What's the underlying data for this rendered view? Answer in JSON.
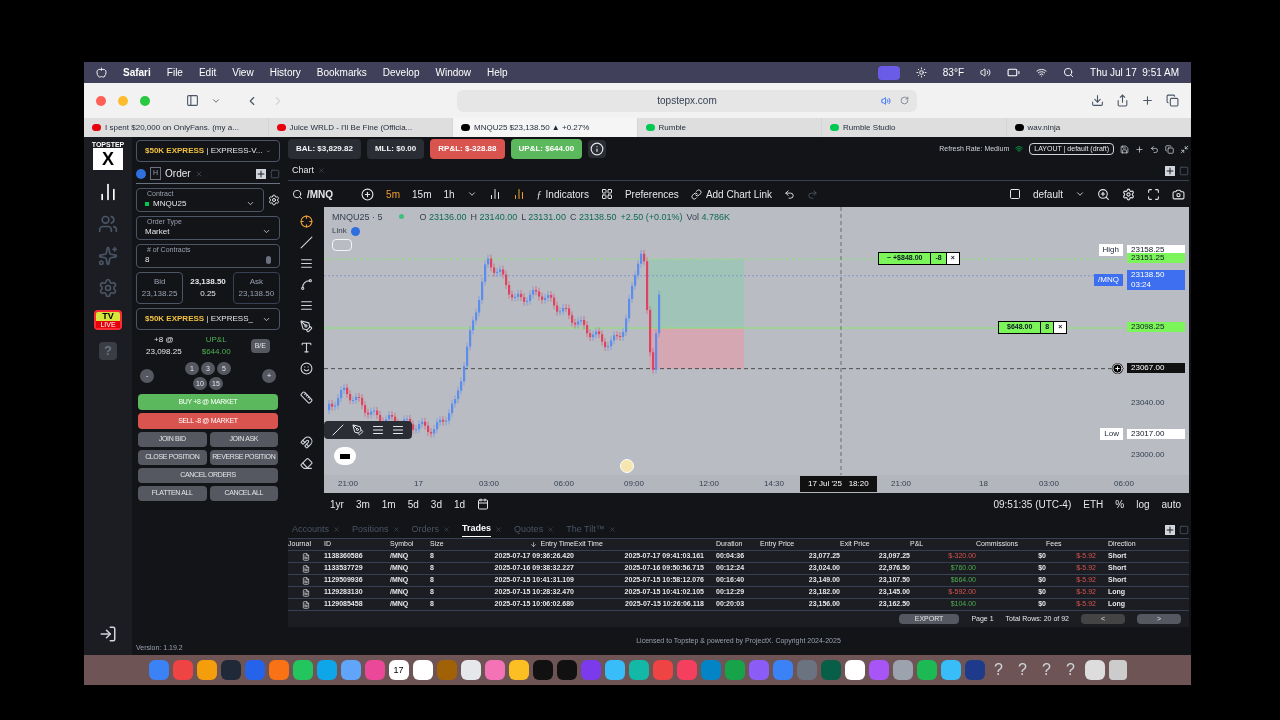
{
  "menubar": {
    "app": "Safari",
    "menus": [
      "File",
      "Edit",
      "View",
      "History",
      "Bookmarks",
      "Develop",
      "Window",
      "Help"
    ],
    "weather": "83°F",
    "clock": "Thu Jul 17  9:51 AM"
  },
  "browser": {
    "url": "topstepx.com",
    "tabs": [
      {
        "title": "I spent $20,000 on OnlyFans. (my a...",
        "selected": false
      },
      {
        "title": "Juice WRLD - I'll Be Fine (Officia...",
        "selected": false
      },
      {
        "title": "MNQU25 $23,138.50 ▲ +0.27%",
        "selected": true
      },
      {
        "title": "Rumble",
        "selected": false
      },
      {
        "title": "Rumble Studio",
        "selected": false
      },
      {
        "title": "wav.ninja",
        "selected": false
      }
    ]
  },
  "rail": {
    "logo_word": "TOPSTEP",
    "logo_letter": "X",
    "tv": "TV",
    "live": "LIVE",
    "help": "?"
  },
  "order_panel": {
    "account": {
      "plan": "$50K EXPRESS",
      "name": "EXPRESS-V..."
    },
    "tab": "Order",
    "tab_badge": "H",
    "fields": [
      {
        "label": "Contract",
        "value": "MNQU25",
        "kind": "select"
      },
      {
        "label": "Order Type",
        "value": "Market",
        "kind": "select"
      },
      {
        "label": "# of Contracts",
        "value": "8",
        "kind": "number"
      }
    ],
    "bid": {
      "label": "Bid",
      "value": "23,138.25"
    },
    "last": {
      "price": "23,138.50",
      "spread": "0.25"
    },
    "ask": {
      "label": "Ask",
      "value": "23,138.50"
    },
    "account2": {
      "plan": "$50K EXPRESS",
      "name": "EXPRESS_"
    },
    "position": {
      "size": "+8 @",
      "price": "23,098.25",
      "upl_label": "UP&L",
      "upl": "$644.00",
      "be": "B/E"
    },
    "minus": "-",
    "plus": "+",
    "quantities": [
      "1",
      "3",
      "5",
      "10",
      "15"
    ],
    "actions": [
      {
        "label": "BUY +8 @ MARKET",
        "kind": "buy"
      },
      {
        "label": "SELL -8 @ MARKET",
        "kind": "sell"
      },
      {
        "label": "JOIN BID",
        "kind": "half"
      },
      {
        "label": "JOIN ASK",
        "kind": "half"
      },
      {
        "label": "CLOSE POSITION",
        "kind": "half"
      },
      {
        "label": "REVERSE POSITION",
        "kind": "half"
      },
      {
        "label": "CANCEL ORDERS",
        "kind": "full"
      },
      {
        "label": "FLATTEN ALL",
        "kind": "half"
      },
      {
        "label": "CANCEL ALL",
        "kind": "half"
      }
    ],
    "version": "Version: 1.19.2",
    "separator": "|"
  },
  "stats": [
    {
      "text": "BAL: $3,829.82",
      "kind": "neutral"
    },
    {
      "text": "MLL: $0.00",
      "kind": "neutral"
    },
    {
      "text": "RP&L: $-328.88",
      "kind": "loss"
    },
    {
      "text": "UP&L: $644.00",
      "kind": "gain"
    }
  ],
  "refresh": "Refresh Rate: Medium",
  "layout": "LAYOUT | default (draft)",
  "chart_panel": {
    "tab": "Chart",
    "symbol": "/MNQ",
    "intervals": [
      {
        "label": "5m",
        "selected": true
      },
      {
        "label": "15m",
        "selected": false
      },
      {
        "label": "1h",
        "selected": false
      }
    ],
    "fx": "ƒ",
    "indicators": "Indicators",
    "preferences": "Preferences",
    "chart_link": "Add Chart Link",
    "layout_name": "default",
    "legend": {
      "title": "MNQU25 · 5",
      "open": "23136.00",
      "high": "23140.00",
      "low": "23131.00",
      "close": "23138.50",
      "change": "+2.50 (+0.01%)",
      "volume": "4.786K",
      "o": "O",
      "h": "H",
      "l": "L",
      "c": "C",
      "vol": "Vol"
    },
    "link": "Link",
    "price_tags": [
      {
        "label": "High",
        "value": "23158.25",
        "kind": "plain"
      },
      {
        "value": "23151.25",
        "kind": "green"
      },
      {
        "label": "/MNQ",
        "value": "23138.50",
        "sub": "03:24",
        "kind": "blue"
      },
      {
        "value": "23098.25",
        "kind": "green"
      },
      {
        "value": "23067.00",
        "kind": "cursor"
      },
      {
        "value": "23040.00",
        "kind": "faint"
      },
      {
        "label": "Low",
        "value": "23017.00",
        "kind": "plain"
      },
      {
        "value": "23000.00",
        "kind": "faint"
      }
    ],
    "order_lines": [
      {
        "pnl": "~ +$848.00",
        "qty": "-8",
        "close": "×"
      },
      {
        "pnl": "$648.00",
        "qty": "8",
        "close": "×"
      }
    ],
    "x_labels": [
      "21:00",
      "17",
      "03:00",
      "06:00",
      "09:00",
      "12:00",
      "14:30",
      "21:00",
      "18",
      "03:00",
      "06:00"
    ],
    "cursor_time": "17 Jul '25   18:20",
    "ranges": [
      "1yr",
      "3m",
      "1m",
      "5d",
      "3d",
      "1d"
    ],
    "time": "09:51:35 (UTC-4)",
    "session": "ETH",
    "percent": "%",
    "log": "log",
    "auto": "auto"
  },
  "bottom": {
    "tabs": [
      {
        "label": "Accounts",
        "selected": false
      },
      {
        "label": "Positions",
        "selected": false
      },
      {
        "label": "Orders",
        "selected": false
      },
      {
        "label": "Trades",
        "selected": true
      },
      {
        "label": "Quotes",
        "selected": false
      },
      {
        "label": "The Tilt™",
        "selected": false
      }
    ],
    "columns": [
      "Journal",
      "ID",
      "Symbol",
      "Size",
      "Entry Time",
      "Exit Time",
      "Duration",
      "Entry Price",
      "Exit Price",
      "P&L",
      "Commissions",
      "Fees",
      "Direction"
    ],
    "rows": [
      {
        "id": "1138360586",
        "symbol": "/MNQ",
        "size": "8",
        "entry_time": "2025-07-17 09:36:26.420",
        "exit_time": "2025-07-17 09:41:03.161",
        "duration": "00:04:36",
        "entry_price": "23,077.25",
        "exit_price": "23,097.25",
        "pnl": "$-320.00",
        "positive": false,
        "commissions": "$0",
        "fees": "$-5.92",
        "direction": "Short"
      },
      {
        "id": "1133537729",
        "symbol": "/MNQ",
        "size": "8",
        "entry_time": "2025-07-16 09:38:32.227",
        "exit_time": "2025-07-16 09:50:56.715",
        "duration": "00:12:24",
        "entry_price": "23,024.00",
        "exit_price": "22,976.50",
        "pnl": "$760.00",
        "positive": true,
        "commissions": "$0",
        "fees": "$-5.92",
        "direction": "Short"
      },
      {
        "id": "1129509936",
        "symbol": "/MNQ",
        "size": "8",
        "entry_time": "2025-07-15 10:41:31.109",
        "exit_time": "2025-07-15 10:58:12.076",
        "duration": "00:16:40",
        "entry_price": "23,149.00",
        "exit_price": "23,107.50",
        "pnl": "$664.00",
        "positive": true,
        "commissions": "$0",
        "fees": "$-5.92",
        "direction": "Short"
      },
      {
        "id": "1129283130",
        "symbol": "/MNQ",
        "size": "8",
        "entry_time": "2025-07-15 10:28:32.470",
        "exit_time": "2025-07-15 10:41:02.105",
        "duration": "00:12:29",
        "entry_price": "23,182.00",
        "exit_price": "23,145.00",
        "pnl": "$-592.00",
        "positive": false,
        "commissions": "$0",
        "fees": "$-5.92",
        "direction": "Long"
      },
      {
        "id": "1129085458",
        "symbol": "/MNQ",
        "size": "8",
        "entry_time": "2025-07-15 10:06:02.680",
        "exit_time": "2025-07-15 10:26:06.118",
        "duration": "00:20:03",
        "entry_price": "23,156.00",
        "exit_price": "23,162.50",
        "pnl": "$104.00",
        "positive": true,
        "commissions": "$0",
        "fees": "$-5.92",
        "direction": "Long"
      }
    ],
    "export": "EXPORT",
    "page": "Page 1",
    "total": "Total Rows: 20 of 92",
    "prev": "<",
    "next": ">"
  },
  "license": "Licensed to Topstep & powered by ProjectX. Copyright 2024-2025",
  "dock": {
    "calendar_day": "17",
    "unknown_apps": [
      "?",
      "?",
      "?",
      "?"
    ]
  }
}
